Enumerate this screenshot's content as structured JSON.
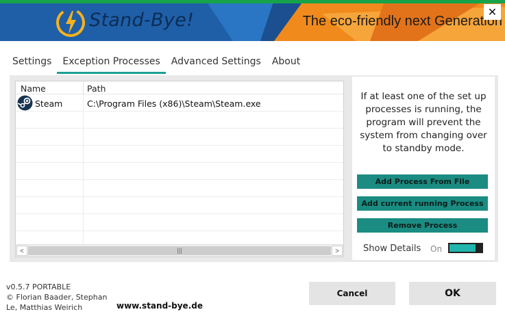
{
  "header": {
    "brand": "Stand-Bye!",
    "tagline": "The eco-friendly next Generation",
    "close_glyph": "✕",
    "icons": {
      "logo": "power-bolt-icon",
      "close": "close-icon"
    }
  },
  "tabs": [
    {
      "label": "Settings",
      "active": false
    },
    {
      "label": "Exception Processes",
      "active": true
    },
    {
      "label": "Advanced Settings",
      "active": false
    },
    {
      "label": "About",
      "active": false
    }
  ],
  "process_list": {
    "columns": [
      "Name",
      "Path"
    ],
    "rows": [
      {
        "name": "Steam",
        "path": "C:\\Program Files (x86)\\Steam\\Steam.exe",
        "icon": "steam-icon"
      }
    ],
    "scroll_left": "<",
    "scroll_right": ">",
    "scroll_grip": "|||"
  },
  "side_panel": {
    "info_text": "If at least one of the set up processes is running, the program will prevent the system from changing over to standby mode.",
    "buttons": {
      "add_from_file": "Add Process From File",
      "add_running": "Add current running Process",
      "remove": "Remove Process"
    },
    "show_details_label": "Show Details",
    "toggle_state": "On",
    "toggle_on": true
  },
  "footer": {
    "version_line1": "v0.5.7 PORTABLE",
    "version_line2": "© Florian Baader, Stephan",
    "version_line3": "Le, Matthias Weirich",
    "website": "www.stand-bye.de",
    "cancel_label": "Cancel",
    "ok_label": "OK"
  },
  "colors": {
    "accent": "#1b8c82",
    "tab_underline": "#1b9e93",
    "banner_blue": "#1f5fa8",
    "banner_orange": "#f08a1c",
    "banner_green": "#17a34a"
  }
}
